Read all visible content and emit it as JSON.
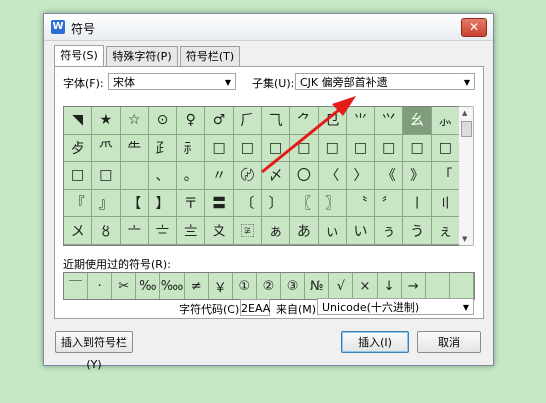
{
  "window": {
    "title": "符号",
    "app_icon_letter": "W",
    "close_glyph": "✕"
  },
  "tabs": [
    {
      "label": "符号(S)"
    },
    {
      "label": "特殊字符(P)"
    },
    {
      "label": "符号栏(T)"
    }
  ],
  "font": {
    "label": "字体(F):",
    "value": "宋体"
  },
  "subset": {
    "label": "子集(U):",
    "value": "CJK 偏旁部首补遗"
  },
  "grid": {
    "rows": [
      [
        "◥",
        "★",
        "☆",
        "⊙",
        "♀",
        "♂",
        "⺁",
        "⺄",
        "⺈",
        "⺋",
        "⺌",
        "⺍",
        "⺓",
        "⺗"
      ],
      [
        "⺞",
        "⺥",
        "⺧",
        "⺪",
        "⺬",
        "□",
        "□",
        "□",
        "□",
        "□",
        "□",
        "□",
        "□",
        "□"
      ],
      [
        "□",
        "□",
        "",
        "、",
        "。",
        "〃",
        "〄",
        "〆",
        "〇",
        "〈",
        "〉",
        "《",
        "》",
        "「"
      ],
      [
        "『",
        "』",
        "【",
        "】",
        "〒",
        "〓",
        "〔",
        "〕",
        "〖",
        "〗",
        "〝",
        "〞",
        "〡",
        "〢"
      ],
      [
        "〤",
        "〥",
        "〦",
        "〧",
        "〨",
        "〩",
        "〾",
        "ぁ",
        "あ",
        "ぃ",
        "い",
        "ぅ",
        "う",
        "ぇ"
      ]
    ],
    "selected_index": 12
  },
  "recent": {
    "label": "近期使用过的符号(R):",
    "items": [
      "￣",
      "·",
      "✂",
      "‰",
      "‱",
      "≠",
      "￥",
      "①",
      "②",
      "③",
      "№",
      "√",
      "×",
      "↓",
      "→",
      "",
      ""
    ]
  },
  "charcode": {
    "label": "字符代码(C):",
    "value": "2EAA"
  },
  "from": {
    "label": "来自(M)",
    "value": "Unicode(十六进制)"
  },
  "buttons": {
    "insert_to_bar": "插入到符号栏(Y)",
    "insert": "插入(I)",
    "cancel": "取消"
  }
}
